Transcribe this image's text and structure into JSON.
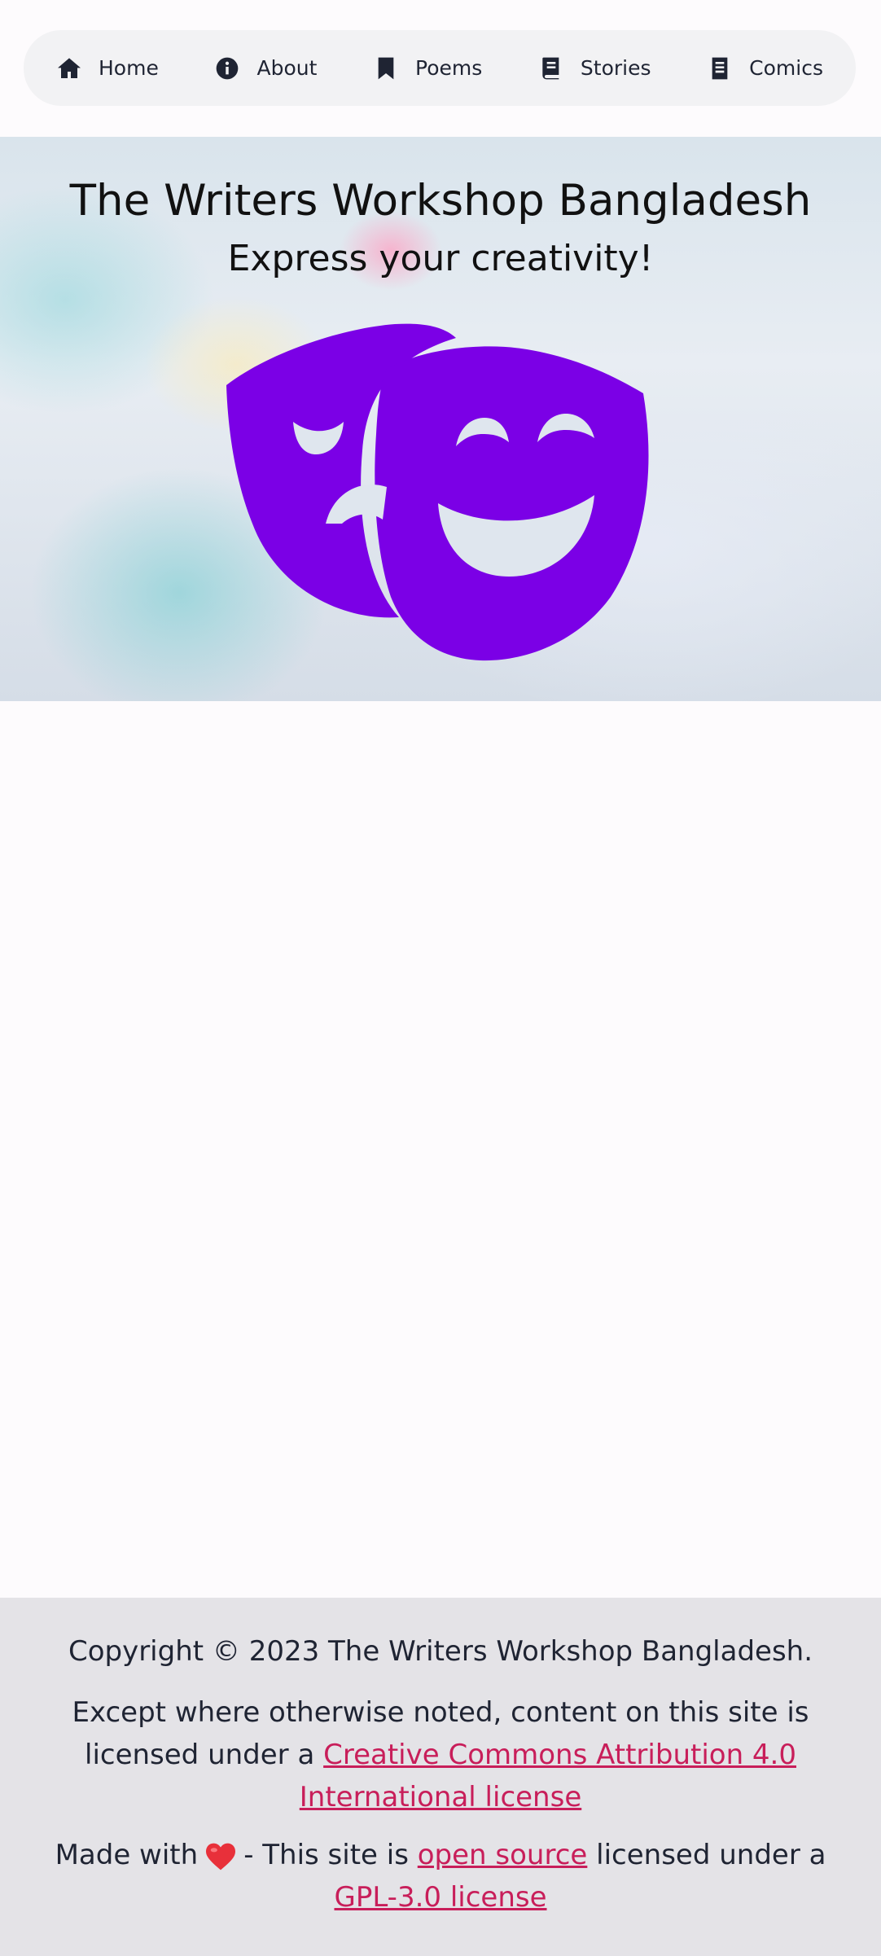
{
  "nav": {
    "items": [
      {
        "label": "Home",
        "icon": "home-icon"
      },
      {
        "label": "About",
        "icon": "info-circle-icon"
      },
      {
        "label": "Poems",
        "icon": "bookmark-icon"
      },
      {
        "label": "Stories",
        "icon": "book-icon"
      },
      {
        "label": "Comics",
        "icon": "document-icon"
      }
    ]
  },
  "hero": {
    "title": "The Writers Workshop Bangladesh",
    "subtitle": "Express your creativity!",
    "icon": "theater-masks-icon",
    "icon_color": "#7b00e6"
  },
  "footer": {
    "copyright": "Copyright © 2023 The Writers Workshop Bangladesh.",
    "license_prefix": "Except where otherwise noted, content on this site is licensed under a",
    "license_link": "Creative Commons Attribution 4.0 International license",
    "made_with": "Made with",
    "made_with_icon": "heart-icon",
    "open_source_prefix": "- This site is",
    "open_source_link": "open source",
    "open_source_middle": "licensed under a",
    "gpl_link": "GPL-3.0 license",
    "link_color": "#c81e5a"
  }
}
